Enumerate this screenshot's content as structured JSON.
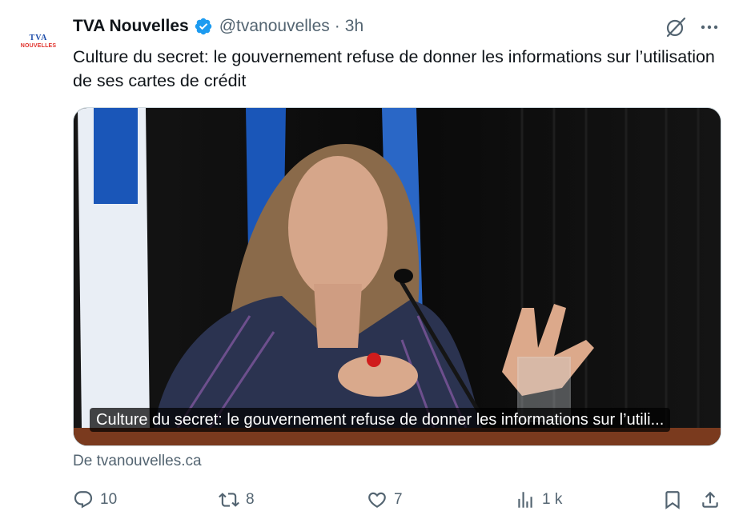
{
  "author": {
    "name": "TVA Nouvelles",
    "handle": "@tvanouvelles",
    "separator": "·",
    "time": "3h",
    "logo_top": "TVA",
    "logo_bottom": "NOUVELLES"
  },
  "tweet": {
    "text": "Culture du secret: le gouvernement refuse de donner les informations sur l’utilisation de ses cartes de crédit"
  },
  "card": {
    "caption": "Culture du secret: le gouvernement refuse de donner les informations sur l’utili...",
    "source": "De tvanouvelles.ca"
  },
  "actions": {
    "replies": "10",
    "reposts": "8",
    "likes": "7",
    "views": "1 k"
  },
  "colors": {
    "verified": "#1d9bf0",
    "icon_gray": "#536471",
    "text": "#0f1419"
  }
}
